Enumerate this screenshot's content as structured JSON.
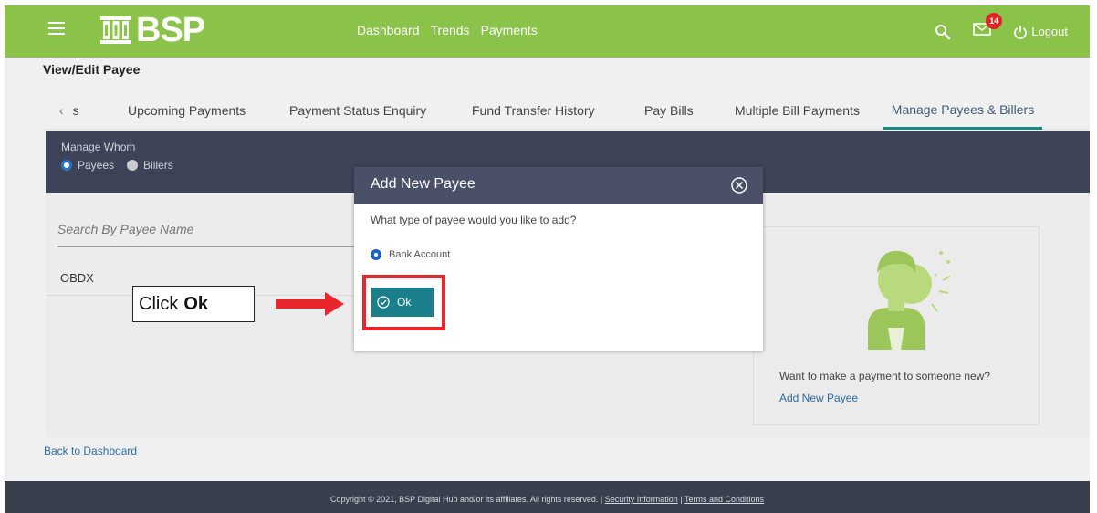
{
  "header": {
    "logo_text": "BSP",
    "nav": [
      "Dashboard",
      "Trends",
      "Payments"
    ],
    "mail_badge": "14",
    "logout_label": "Logout",
    "bg_color": "#8bc34a",
    "icons": [
      "hamburger-icon",
      "search-icon",
      "mail-icon",
      "power-icon"
    ]
  },
  "page": {
    "title": "View/Edit Payee"
  },
  "tabs": {
    "prev_partial": "s",
    "items": [
      "Upcoming Payments",
      "Payment Status Enquiry",
      "Fund Transfer History",
      "Pay Bills",
      "Multiple Bill Payments",
      "Manage Payees & Billers"
    ],
    "active": "Manage Payees & Billers"
  },
  "manage": {
    "label": "Manage Whom",
    "options": [
      "Payees",
      "Billers"
    ],
    "selected": "Payees"
  },
  "list": {
    "search_placeholder": "Search By Payee Name",
    "items": [
      "OBDX"
    ]
  },
  "card": {
    "text": "Want to make a payment to someone new?",
    "link": "Add New Payee"
  },
  "back_link": "Back to Dashboard",
  "footer": {
    "copyright": "Copyright © 2021, BSP Digital Hub and/or its affiliates. All rights reserved. |",
    "security_link": "Security Information",
    "sep": "|",
    "terms_link": "Terms and Conditions"
  },
  "modal": {
    "title": "Add New Payee",
    "question": "What type of payee would you like to add?",
    "option": "Bank Account",
    "ok_label": "Ok"
  },
  "annotation": {
    "callout_prefix": "Click",
    "callout_bold": "Ok",
    "highlight_color": "#e8262b"
  }
}
